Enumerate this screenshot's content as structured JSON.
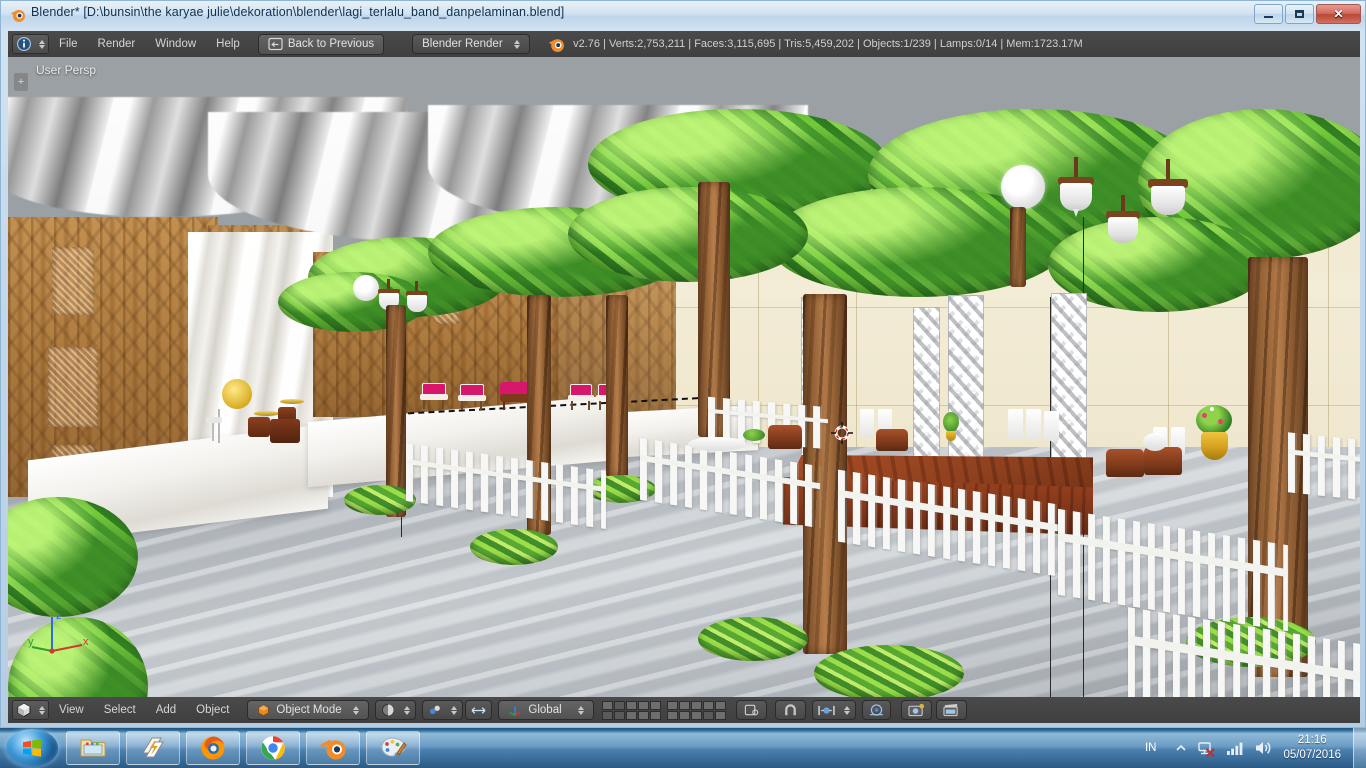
{
  "window": {
    "title": "Blender* [D:\\bunsin\\the karyae julie\\dekoration\\blender\\lagi_terlalu_band_danpelaminan.blend]",
    "app_icon": "blender-icon",
    "minimize_label": "Minimize",
    "maximize_label": "Maximize",
    "close_label": "Close"
  },
  "header": {
    "editor_type_icon": "info-editor-icon",
    "menus": [
      "File",
      "Render",
      "Window",
      "Help"
    ],
    "back_button": {
      "label": "Back to Previous",
      "icon": "screen-back-icon"
    },
    "engine": {
      "label": "Blender Render",
      "icon": "chevron-updown-icon"
    },
    "blender_logo": "blender-logo-icon",
    "stats": "v2.76 | Verts:2,753,211 | Faces:3,115,695 | Tris:5,459,202 | Objects:1/239 | Lamps:0/14 | Mem:1723.17M",
    "stats_parts": {
      "version": "v2.76",
      "verts": "Verts:2,753,211",
      "faces": "Faces:3,115,695",
      "tris": "Tris:5,459,202",
      "objects": "Objects:1/239",
      "lamps": "Lamps:0/14",
      "mem": "Mem:1723.17M"
    }
  },
  "viewport": {
    "perspective_label": "User Persp",
    "panel_toggle": "+",
    "axis": {
      "x": "x",
      "y": "y",
      "z": "z"
    },
    "cursor_icon": "3d-cursor-icon"
  },
  "footer": {
    "editor_type_icon": "view3d-editor-icon",
    "menus": [
      "View",
      "Select",
      "Add",
      "Object"
    ],
    "mode": {
      "label": "Object Mode",
      "icon": "object-mode-cube-icon"
    },
    "shading_icon": "viewport-shading-icon",
    "pivot_icon": "pivot-point-icon",
    "manipulator_icon": "transform-manipulator-icon",
    "orientation": {
      "label": "Global",
      "icon": "axis-orientation-icon"
    },
    "snap_icon": "magnet-snap-icon",
    "proportional_icon": "proportional-edit-icon",
    "proportional_falloff_icon": "smooth-falloff-icon",
    "render_icon": "render-image-icon",
    "animation_icon": "render-animation-icon",
    "layers_label": "Scene Layers"
  },
  "taskbar": {
    "start_label": "Start",
    "items": [
      {
        "name": "file-explorer-icon",
        "label": "Windows Explorer"
      },
      {
        "name": "winamp-icon",
        "label": "Winamp"
      },
      {
        "name": "firefox-icon",
        "label": "Mozilla Firefox"
      },
      {
        "name": "chrome-icon",
        "label": "Google Chrome"
      },
      {
        "name": "blender-taskbar-icon",
        "label": "Blender"
      },
      {
        "name": "paint-icon",
        "label": "Paint"
      }
    ],
    "tray": {
      "language": "IN",
      "show_hidden_icon": "chevron-up-icon",
      "network_icon": "network-disconnected-icon",
      "signal_icon": "signal-bars-icon",
      "volume_icon": "speaker-icon",
      "time": "21:16",
      "date": "05/07/2016",
      "show_desktop_label": "Show desktop"
    }
  },
  "scene": {
    "description": "3D wedding reception hall (pelaminan) with draped fabric ceiling, carved wooden wall panels, green tree canopies, hanging white lanterns, white picket fences, lattice truss columns, wooden stage, pink chairs and a drum set",
    "colors": {
      "floor": "#b2b8bd",
      "leaf_green": "#7dc242",
      "trunk_brown": "#9a6638",
      "stage_wood": "#8a3d1c",
      "fence_white": "#f7f7f5",
      "chair_pink": "#d6176b",
      "pot_gold": "#d4a020",
      "wall_cream": "#f1e9cf",
      "carved_wood": "#a9763a"
    }
  }
}
